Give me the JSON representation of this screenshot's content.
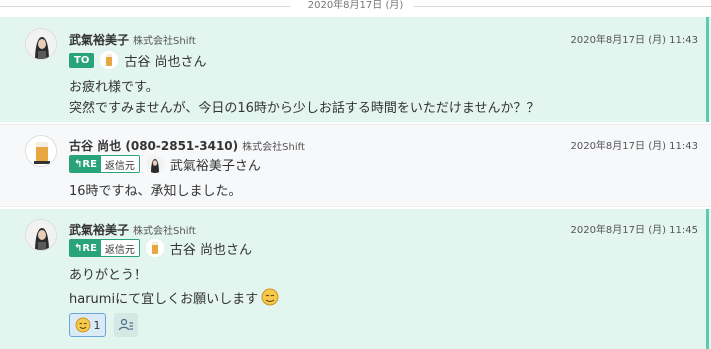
{
  "date_divider": "2020年8月17日 (月)",
  "messages": [
    {
      "sender": "武氣裕美子",
      "company": "株式会社Shift",
      "time": "2020年8月17日 (月) 11:43",
      "tag": "TO",
      "target": "古谷 尚也さん",
      "lines": [
        "お疲れ様です。",
        "突然ですみませんが、今日の16時から少しお話する時間をいただけませんか？？"
      ]
    },
    {
      "sender": "古谷 尚也 (080-2851-3410)",
      "company": "株式会社Shift",
      "time": "2020年8月17日 (月) 11:43",
      "tag_re": "RE",
      "tag_src": "返信元",
      "target": "武氣裕美子さん",
      "lines": [
        "16時ですね、承知しました。"
      ]
    },
    {
      "sender": "武氣裕美子",
      "company": "株式会社Shift",
      "time": "2020年8月17日 (月) 11:45",
      "tag_re": "RE",
      "tag_src": "返信元",
      "target": "古谷 尚也さん",
      "lines": [
        "ありがとう！",
        "harumiにて宜しくお願いします"
      ],
      "reaction_count": "1"
    }
  ],
  "colors": {
    "accent": "#29a37a",
    "highlight_bg": "#e3f5ef",
    "highlight_bar": "#5fc8b0",
    "reaction_border": "#6aa7d8"
  }
}
